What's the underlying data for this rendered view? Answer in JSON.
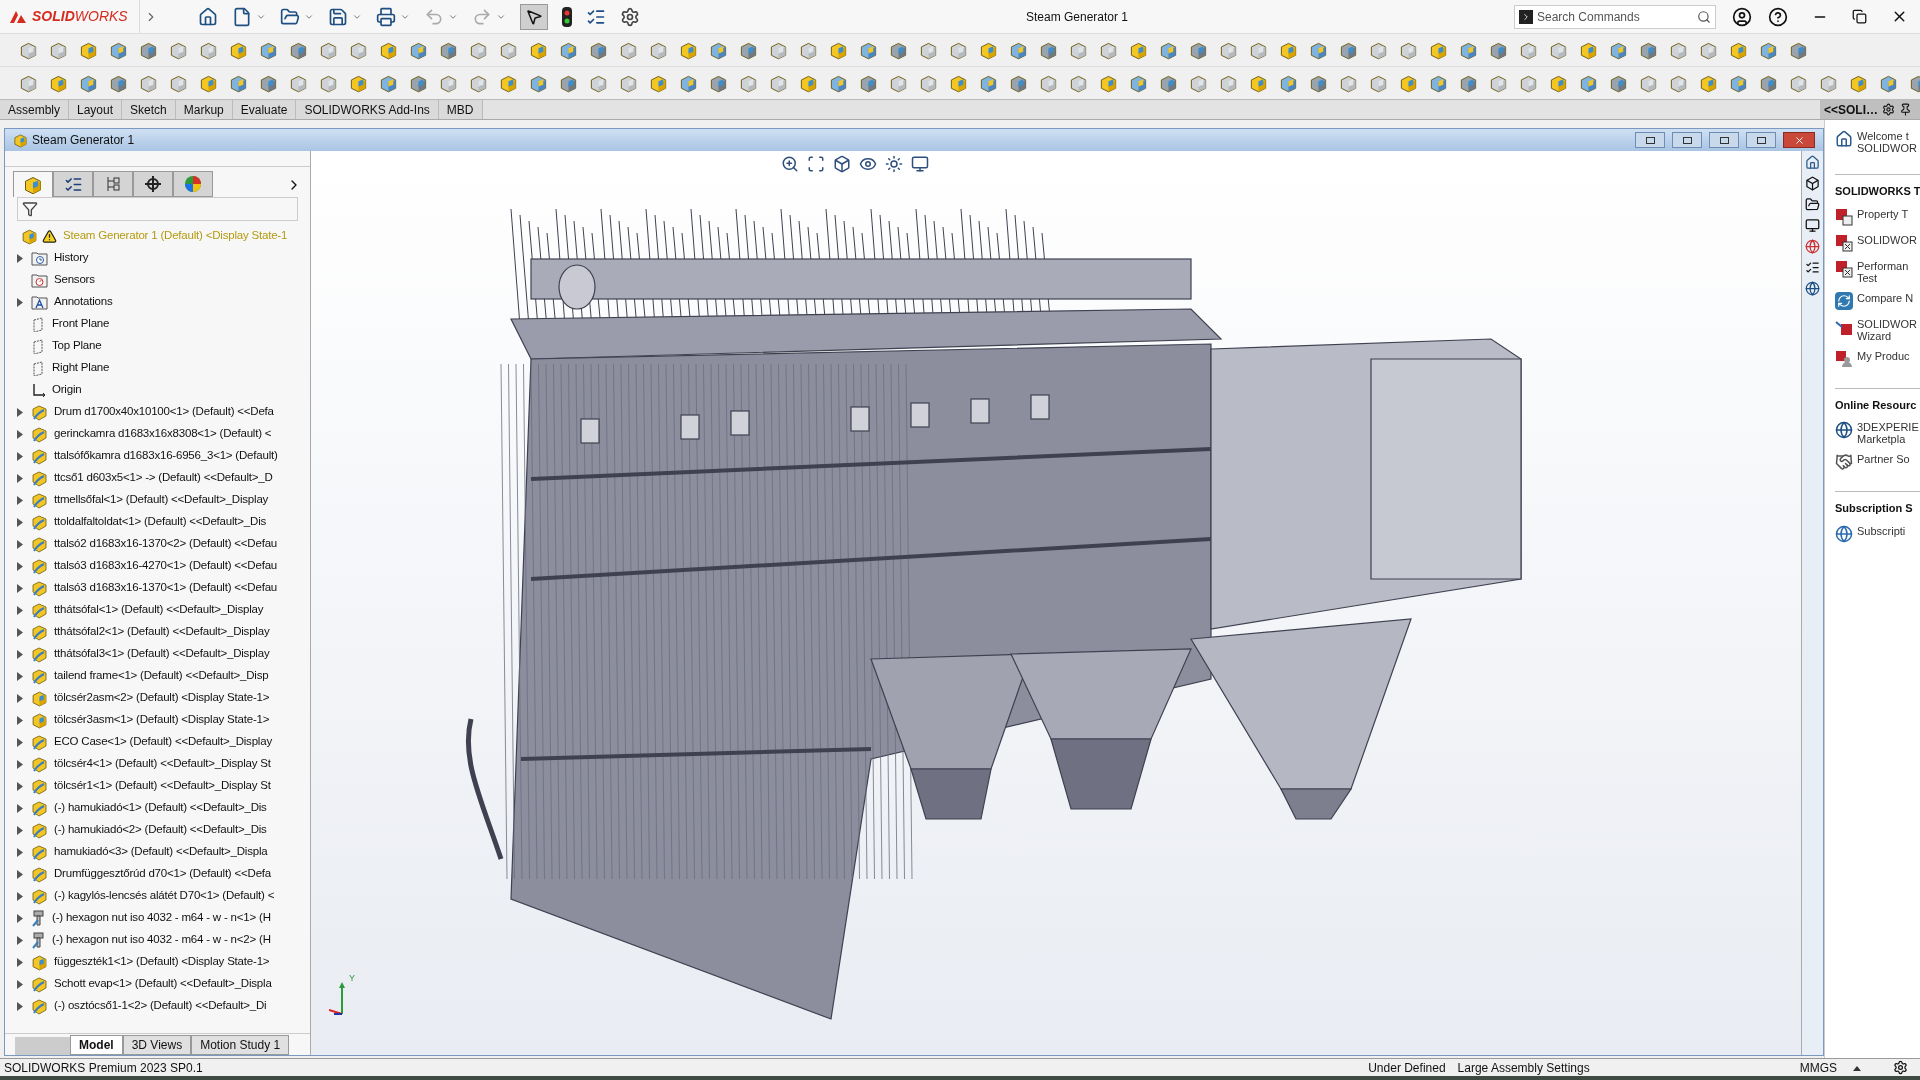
{
  "app": {
    "logo": "**SOLID**WORKS",
    "title": "Steam Generator 1",
    "search": {
      "placeholder": "Search Commands"
    }
  },
  "command_tabs": [
    {
      "label": "Assembly",
      "selected": false
    },
    {
      "label": "Layout",
      "selected": false
    },
    {
      "label": "Sketch",
      "selected": false
    },
    {
      "label": "Markup",
      "selected": false
    },
    {
      "label": "Evaluate",
      "selected": false
    },
    {
      "label": "SOLIDWORKS Add-Ins",
      "selected": false
    },
    {
      "label": "MBD",
      "selected": false
    }
  ],
  "document": {
    "title": "Steam Generator 1"
  },
  "manager_tabs": [
    {
      "kind": "tree",
      "selected": true
    },
    {
      "kind": "properties",
      "selected": false
    },
    {
      "kind": "config",
      "selected": false
    },
    {
      "kind": "dim",
      "selected": false
    },
    {
      "kind": "display",
      "selected": false
    }
  ],
  "tree": [
    {
      "kind": "root",
      "label": "Steam Generator 1 (Default) <Display State-1",
      "expandable": false
    },
    {
      "kind": "history",
      "label": "History",
      "expandable": true
    },
    {
      "kind": "sensors",
      "label": "Sensors",
      "expandable": false
    },
    {
      "kind": "annotations",
      "label": "Annotations",
      "expandable": true
    },
    {
      "kind": "plane",
      "label": "Front Plane",
      "expandable": false
    },
    {
      "kind": "plane",
      "label": "Top Plane",
      "expandable": false
    },
    {
      "kind": "plane",
      "label": "Right Plane",
      "expandable": false
    },
    {
      "kind": "origin",
      "label": "Origin",
      "expandable": false
    },
    {
      "kind": "part",
      "label": "Drum d1700x40x10100<1> (Default) <<Defa",
      "expandable": true
    },
    {
      "kind": "part",
      "label": "gerinckamra d1683x16x8308<1> (Default) <",
      "expandable": true
    },
    {
      "kind": "part",
      "label": "ttalsófőkamra d1683x16-6956_3<1> (Default)",
      "expandable": true
    },
    {
      "kind": "part",
      "label": "ttcső1 d603x5<1> -> (Default) <<Default>_D",
      "expandable": true
    },
    {
      "kind": "part",
      "label": "ttmellsőfal<1> (Default) <<Default>_Display",
      "expandable": true
    },
    {
      "kind": "part",
      "label": "ttoldalfaltoldat<1> (Default) <<Default>_Dis",
      "expandable": true
    },
    {
      "kind": "part",
      "label": "ttalsó2 d1683x16-1370<2> (Default) <<Defau",
      "expandable": true
    },
    {
      "kind": "part",
      "label": "ttalsó3 d1683x16-4270<1> (Default) <<Defau",
      "expandable": true
    },
    {
      "kind": "part",
      "label": "ttalsó3 d1683x16-1370<1> (Default) <<Defau",
      "expandable": true
    },
    {
      "kind": "part",
      "label": "tthátsófal<1> (Default) <<Default>_Display",
      "expandable": true
    },
    {
      "kind": "part",
      "label": "tthátsófal2<1> (Default) <<Default>_Display",
      "expandable": true
    },
    {
      "kind": "part",
      "label": "tthátsófal3<1> (Default) <<Default>_Display",
      "expandable": true
    },
    {
      "kind": "part",
      "label": "tailend frame<1> (Default) <<Default>_Disp",
      "expandable": true
    },
    {
      "kind": "assembly",
      "label": "tölcsér2asm<2> (Default) <Display State-1>",
      "expandable": true
    },
    {
      "kind": "assembly",
      "label": "tölcsér3asm<1> (Default) <Display State-1>",
      "expandable": true
    },
    {
      "kind": "part",
      "label": "ECO Case<1> (Default) <<Default>_Display",
      "expandable": true
    },
    {
      "kind": "part",
      "label": "tölcsér4<1> (Default) <<Default>_Display St",
      "expandable": true
    },
    {
      "kind": "part",
      "label": "tölcsér1<1> (Default) <<Default>_Display St",
      "expandable": true
    },
    {
      "kind": "part",
      "label": "(-) hamukiadó<1> (Default) <<Default>_Dis",
      "expandable": true
    },
    {
      "kind": "part",
      "label": "(-) hamukiadó<2> (Default) <<Default>_Dis",
      "expandable": true
    },
    {
      "kind": "part",
      "label": "hamukiadó<3> (Default) <<Default>_Displa",
      "expandable": true
    },
    {
      "kind": "part",
      "label": "Drumfüggesztőrúd d70<1> (Default) <<Defa",
      "expandable": true
    },
    {
      "kind": "part",
      "label": "(-) kagylós-lencsés alátét D70<1> (Default) <",
      "expandable": true
    },
    {
      "kind": "fastener",
      "label": "(-) hexagon nut iso 4032 - m64 - w - n<1> (H",
      "expandable": true
    },
    {
      "kind": "fastener",
      "label": "(-) hexagon nut iso 4032 - m64 - w - n<2> (H",
      "expandable": true
    },
    {
      "kind": "assembly",
      "label": "függeszték1<1> (Default) <Display State-1>",
      "expandable": true
    },
    {
      "kind": "part",
      "label": "Schott evap<1> (Default) <<Default>_Displa",
      "expandable": true
    },
    {
      "kind": "part",
      "label": "(-) osztócső1-1<2> (Default) <<Default>_Di",
      "expandable": true
    }
  ],
  "bottom_tabs": [
    {
      "label": "Model",
      "selected": true
    },
    {
      "label": "3D Views",
      "selected": false
    },
    {
      "label": "Motion Study 1",
      "selected": false
    }
  ],
  "triad": {
    "label": "Y"
  },
  "task_pane": {
    "title": "<<SOLI…",
    "groups": [
      {
        "items": [
          {
            "kind": "home",
            "lines": [
              "Welcome t",
              "SOLIDWOR"
            ]
          }
        ]
      },
      {
        "heading": "SOLIDWORKS T",
        "items": [
          {
            "kind": "property",
            "lines": [
              "Property T"
            ]
          },
          {
            "kind": "fx",
            "lines": [
              "SOLIDWOR"
            ]
          },
          {
            "kind": "fx",
            "lines": [
              "Performan",
              "Test"
            ]
          },
          {
            "kind": "compare",
            "lines": [
              "Compare N"
            ]
          },
          {
            "kind": "wizard",
            "lines": [
              "SOLIDWOR",
              "Wizard"
            ]
          },
          {
            "kind": "products",
            "lines": [
              "My Produc"
            ]
          }
        ]
      },
      {
        "heading": "Online Resourc",
        "items": [
          {
            "kind": "globe",
            "lines": [
              "3DEXPERIE",
              "Marketpla"
            ]
          },
          {
            "kind": "handshake",
            "lines": [
              "Partner So"
            ]
          }
        ]
      },
      {
        "heading": "Subscription S",
        "items": [
          {
            "kind": "subscription",
            "lines": [
              "Subscripti"
            ]
          }
        ]
      }
    ]
  },
  "status_bar": {
    "product": "SOLIDWORKS Premium 2023 SP0.1",
    "state": "Under Defined",
    "settings": "Large Assembly Settings",
    "units": "MMGS"
  }
}
